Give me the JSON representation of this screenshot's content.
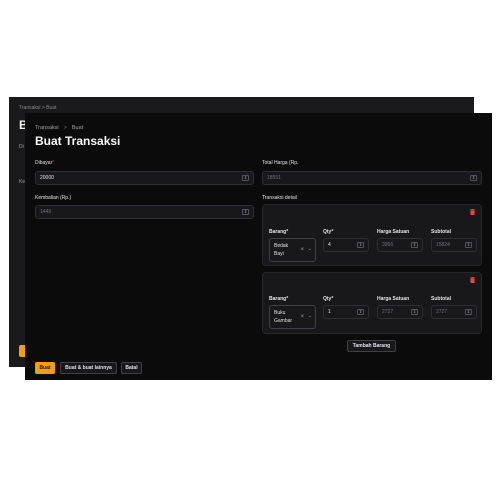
{
  "background_window": {
    "breadcrumb": "Transaksi  >  Buat",
    "title_fragment": "B",
    "label_fragment_1": "Di",
    "label_fragment_2": "Ke"
  },
  "breadcrumb": {
    "parent": "Transaksi",
    "separator": ">",
    "current": "Buat"
  },
  "page_title": "Buat Transaksi",
  "form": {
    "dibayar": {
      "label": "Dibayar",
      "required_mark": "*",
      "value": "20000"
    },
    "kembalian": {
      "label": "Kembalian (Rp.)",
      "value": "1449"
    },
    "total_harga": {
      "label": "Total Harga (Rp.",
      "value": "18551"
    }
  },
  "transaksi_detail": {
    "label": "Transaksi detail",
    "columns": {
      "barang": "Barang",
      "qty": "Qty",
      "harga_satuan": "Harga Satuan",
      "subtotal": "Subtotal",
      "required_mark": "*"
    },
    "items": [
      {
        "barang_line1": "Bedak",
        "barang_line2": "Bayi",
        "qty": "4",
        "harga_satuan": "3956",
        "subtotal": "15824"
      },
      {
        "barang_line1": "Buku",
        "barang_line2": "Gambar",
        "qty": "1",
        "harga_satuan": "2727",
        "subtotal": "2727"
      }
    ],
    "add_button": "Tambah Barang"
  },
  "actions": {
    "create": "Buat",
    "create_another": "Buat & buat lainnya",
    "cancel": "Batal"
  },
  "colors": {
    "accent": "#f59e0b",
    "danger": "#ef4444",
    "background": "#0b0b0c",
    "card": "#18181b"
  },
  "icons": {
    "delete": "trash-icon",
    "clear": "x-icon",
    "dropdown": "chevron-down-icon",
    "stepper": "stepper-icon"
  }
}
